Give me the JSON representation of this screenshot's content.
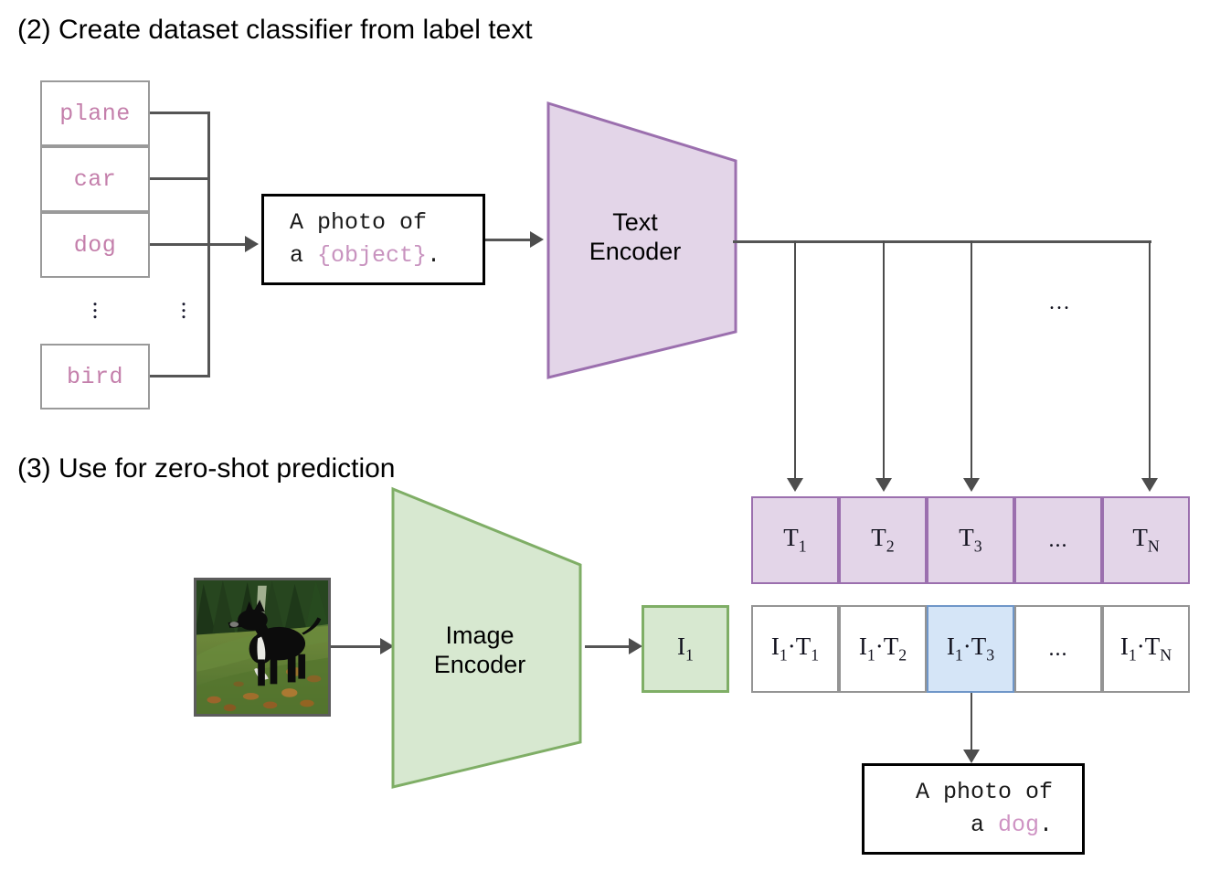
{
  "headings": {
    "step2": "(2) Create dataset classifier from label text",
    "step3": "(3) Use for zero-shot prediction"
  },
  "labels": {
    "items": [
      {
        "text": "plane"
      },
      {
        "text": "car"
      },
      {
        "text": "dog"
      },
      {
        "text": "bird"
      }
    ],
    "ellipsis": "⋮"
  },
  "prompt_template": {
    "line1": "A photo of",
    "line2_prefix": "a ",
    "line2_token": "{object}",
    "line2_suffix": "."
  },
  "prompt_result": {
    "line1": "A photo of",
    "line2_prefix": "a ",
    "line2_token": "dog",
    "line2_suffix": "."
  },
  "text_encoder": {
    "line1": "Text",
    "line2": "Encoder"
  },
  "image_encoder": {
    "line1": "Image",
    "line2": "Encoder"
  },
  "image_embedding": {
    "symbol": "I",
    "subscript": "1"
  },
  "text_embeddings": {
    "row_label": "T",
    "cells": [
      {
        "symbol": "T",
        "sub": "1",
        "is_ellipsis": false
      },
      {
        "symbol": "T",
        "sub": "2",
        "is_ellipsis": false
      },
      {
        "symbol": "T",
        "sub": "3",
        "is_ellipsis": false
      },
      {
        "symbol": "",
        "sub": "",
        "is_ellipsis": true,
        "text": "..."
      },
      {
        "symbol": "T",
        "sub": "N",
        "is_ellipsis": false
      }
    ]
  },
  "similarity_row": {
    "cells": [
      {
        "text": "I₁·T₁",
        "i_sub": "1",
        "t_sub": "1",
        "is_ellipsis": false,
        "highlighted": false
      },
      {
        "text": "I₁·T₂",
        "i_sub": "1",
        "t_sub": "2",
        "is_ellipsis": false,
        "highlighted": false
      },
      {
        "text": "I₁·T₃",
        "i_sub": "1",
        "t_sub": "3",
        "is_ellipsis": false,
        "highlighted": true
      },
      {
        "text": "...",
        "i_sub": "",
        "t_sub": "",
        "is_ellipsis": true,
        "highlighted": false
      },
      {
        "text": "I₁·Tₙ",
        "i_sub": "1",
        "t_sub": "N",
        "is_ellipsis": false,
        "highlighted": false
      }
    ]
  },
  "bus_ellipsis": "...",
  "photo": {
    "alt": "photograph of a black dog standing in a grassy field with trees"
  },
  "colors": {
    "text_purple_fill": "#e3d5e8",
    "text_purple_border": "#9b6fae",
    "image_green_fill": "#d7e8d0",
    "image_green_border": "#7fae66",
    "highlight_blue_fill": "#d5e5f7",
    "highlight_blue_border": "#6f96c8",
    "label_pink": "#c47fab",
    "connector_gray": "#4d4d4d"
  }
}
